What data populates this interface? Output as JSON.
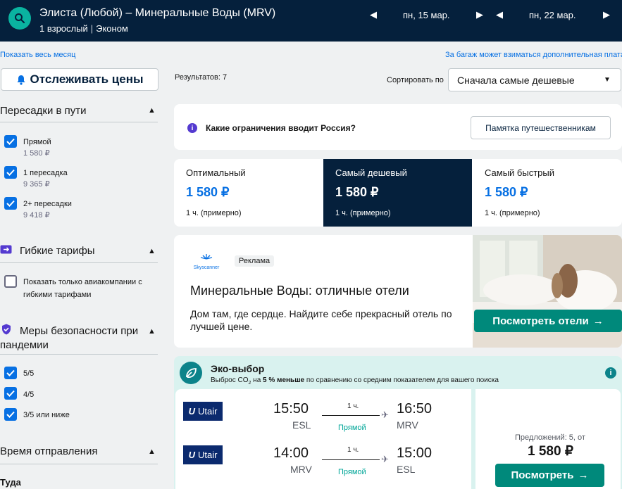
{
  "header": {
    "route": "Элиста (Любой) – Минеральные Воды (MRV)",
    "passengers": "1 взрослый",
    "cabin": "Эконом",
    "depart_date": "пн, 15 мар.",
    "return_date": "пн, 22 мар."
  },
  "subbar": {
    "show_month": "Показать весь месяц",
    "baggage_note": "За багаж может взиматься дополнительная плата"
  },
  "sidebar": {
    "track_prices": "Отслеживать цены",
    "stops": {
      "title": "Пересадки в пути",
      "options": [
        {
          "label": "Прямой",
          "price": "1 580 ₽",
          "checked": true
        },
        {
          "label": "1 пересадка",
          "price": "9 365 ₽",
          "checked": true
        },
        {
          "label": "2+ пересадки",
          "price": "9 418 ₽",
          "checked": true
        }
      ]
    },
    "flexible": {
      "title": "Гибкие тарифы",
      "option_line1": "Показать только авиакомпании с",
      "option_line2": "гибкими тарифами",
      "checked": false
    },
    "safety": {
      "title_line1": "Меры безопасности при",
      "title_line2": "пандемии",
      "options": [
        {
          "label": "5/5",
          "checked": true
        },
        {
          "label": "4/5",
          "checked": true
        },
        {
          "label": "3/5 или ниже",
          "checked": true
        }
      ]
    },
    "departure": {
      "title": "Время отправления",
      "sub": "Туда"
    }
  },
  "main": {
    "results": "Результатов: 7",
    "sort_label": "Сортировать по",
    "sort_value": "Сначала самые дешевые",
    "restrictions": {
      "question": "Какие ограничения вводит Россия?",
      "button": "Памятка путешественникам"
    },
    "tabs": [
      {
        "label": "Оптимальный",
        "price": "1 580 ₽",
        "duration": "1 ч. (примерно)",
        "selected": false
      },
      {
        "label": "Самый дешевый",
        "price": "1 580 ₽",
        "duration": "1 ч. (примерно)",
        "selected": true
      },
      {
        "label": "Самый быстрый",
        "price": "1 580 ₽",
        "duration": "1 ч. (примерно)",
        "selected": false
      }
    ],
    "ad": {
      "brand": "Skyscanner",
      "badge": "Реклама",
      "title": "Минеральные Воды: отличные отели",
      "description": "Дом там, где сердце. Найдите себе прекрасный отель по лучшей цене.",
      "button": "Посмотреть отели"
    },
    "eco": {
      "title": "Эко-выбор",
      "desc_prefix": "Выброс CO",
      "desc_sub": "2",
      "desc_mid": " на ",
      "desc_bold": "5 % меньше",
      "desc_suffix": " по сравнению со средним показателем для вашего поиска"
    },
    "flights": [
      {
        "airline": "Utair",
        "dep_time": "15:50",
        "dep_code": "ESL",
        "duration": "1 ч.",
        "stops": "Прямой",
        "arr_time": "16:50",
        "arr_code": "MRV"
      },
      {
        "airline": "Utair",
        "dep_time": "14:00",
        "dep_code": "MRV",
        "duration": "1 ч.",
        "stops": "Прямой",
        "arr_time": "15:00",
        "arr_code": "ESL"
      }
    ],
    "offer": {
      "offers": "Предложений: 5, от",
      "price": "1 580 ₽",
      "button": "Посмотреть"
    }
  },
  "colors": {
    "header_bg": "#05203c",
    "accent_blue": "#0770e3",
    "green_button": "#00897b",
    "eco_bg": "#d9f2ef"
  }
}
